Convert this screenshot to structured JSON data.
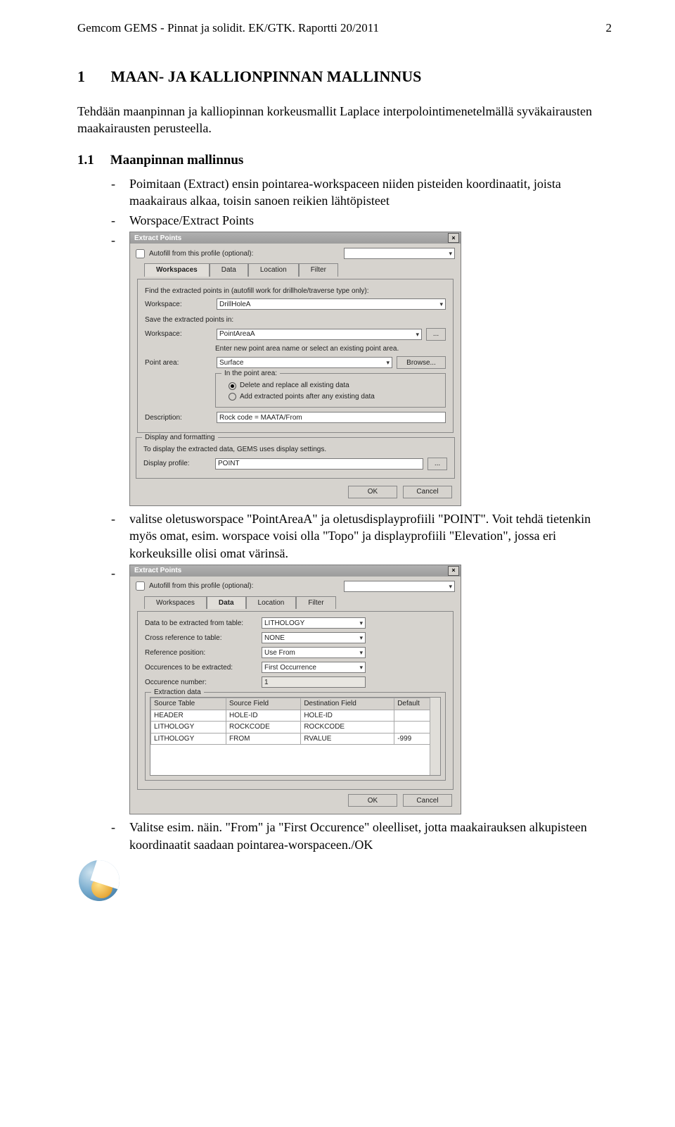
{
  "header": {
    "left": "Gemcom GEMS - Pinnat ja solidit. EK/GTK. Raportti 20/2011",
    "right": "2"
  },
  "section": {
    "num": "1",
    "title": "MAAN- JA KALLIONPINNAN MALLINNUS",
    "intro": "Tehdään maanpinnan ja kalliopinnan korkeusmallit Laplace interpolointimenetelmällä syväkairausten maakairausten perusteella."
  },
  "subsection": {
    "num": "1.1",
    "title": "Maanpinnan mallinnus"
  },
  "bullets1": {
    "b1": "Poimitaan (Extract) ensin pointarea-workspaceen niiden pisteiden koordinaatit, joista maakairaus alkaa, toisin sanoen reikien lähtöpisteet",
    "b2": "Worspace/Extract Points"
  },
  "dlg1": {
    "title": "Extract Points",
    "autofill_label": "Autofill from this profile (optional):",
    "tabs": {
      "t1": "Workspaces",
      "t2": "Data",
      "t3": "Location",
      "t4": "Filter"
    },
    "note_find": "Find the extracted points in (autofill work for drillhole/traverse type only):",
    "ws_label": "Workspace:",
    "ws_val": "DrillHoleA",
    "note_save": "Save the extracted points in:",
    "ws2_val": "PointAreaA",
    "note_enter": "Enter new point area name or select an existing point area.",
    "pa_label": "Point area:",
    "pa_val": "Surface",
    "browse": "Browse...",
    "pa_group": "In the point area:",
    "r1": "Delete and replace all existing data",
    "r2": "Add extracted points after any existing data",
    "desc_label": "Description:",
    "desc_val": "Rock code = MAATA/From",
    "disp_group": "Display and formatting",
    "disp_note": "To display the extracted data, GEMS uses display settings.",
    "dp_label": "Display profile:",
    "dp_val": "POINT",
    "ok": "OK",
    "cancel": "Cancel"
  },
  "midtext": "valitse oletusworspace \"PointAreaA\" ja oletusdisplayprofiili \"POINT\". Voit tehdä tietenkin myös omat, esim. worspace voisi olla \"Topo\" ja displayprofiili \"Elevation\", jossa eri korkeuksille olisi omat värinsä.",
  "dlg2": {
    "title": "Extract Points",
    "autofill_label": "Autofill from this profile (optional):",
    "tabs": {
      "t1": "Workspaces",
      "t2": "Data",
      "t3": "Location",
      "t4": "Filter"
    },
    "l_table": "Data to be extracted from table:",
    "v_table": "LITHOLOGY",
    "l_xref": "Cross reference to table:",
    "v_xref": "NONE",
    "l_ref": "Reference position:",
    "v_ref": "Use From",
    "l_occ": "Occurences to be extracted:",
    "v_occ": "First Occurrence",
    "l_occn": "Occurence number:",
    "v_occn": "1",
    "grp": "Extraction data",
    "th": {
      "c1": "Source Table",
      "c2": "Source Field",
      "c3": "Destination Field",
      "c4": "Default"
    },
    "rows": [
      {
        "c1": "HEADER",
        "c2": "HOLE-ID",
        "c3": "HOLE-ID",
        "c4": ""
      },
      {
        "c1": "LITHOLOGY",
        "c2": "ROCKCODE",
        "c3": "ROCKCODE",
        "c4": ""
      },
      {
        "c1": "LITHOLOGY",
        "c2": "FROM",
        "c3": "RVALUE",
        "c4": "-999"
      }
    ],
    "ok": "OK",
    "cancel": "Cancel"
  },
  "endtext": "Valitse esim. näin. \"From\" ja \"First Occurence\" oleelliset, jotta maakairauksen alkupisteen koordinaatit saadaan pointarea-worspaceen./OK"
}
